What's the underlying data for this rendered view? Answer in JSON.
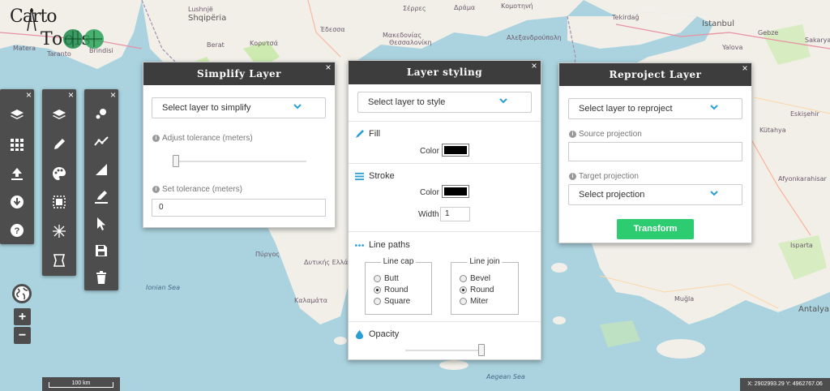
{
  "app": {
    "logo_line1": "Carto",
    "logo_line2": "Tools"
  },
  "map": {
    "labels": [
      {
        "text": "Lushnjë",
        "cls": ""
      },
      {
        "text": "Shqipëria",
        "cls": "big"
      },
      {
        "text": "Berat",
        "cls": ""
      },
      {
        "text": "Κορυτσά",
        "cls": ""
      },
      {
        "text": "Σέρρες",
        "cls": ""
      },
      {
        "text": "Δράμα",
        "cls": ""
      },
      {
        "text": "Κομοτηνή",
        "cls": ""
      },
      {
        "text": "Θεσσαλονίκη",
        "cls": ""
      },
      {
        "text": "Έδεσσα",
        "cls": ""
      },
      {
        "text": "Μακεδονίας",
        "cls": ""
      },
      {
        "text": "Αλεξανδρούπολη",
        "cls": ""
      },
      {
        "text": "Tekirdağ",
        "cls": ""
      },
      {
        "text": "Istanbul",
        "cls": "big"
      },
      {
        "text": "Gebze",
        "cls": ""
      },
      {
        "text": "Sakarya",
        "cls": ""
      },
      {
        "text": "Yalova",
        "cls": ""
      },
      {
        "text": "Matera",
        "cls": ""
      },
      {
        "text": "Taranto",
        "cls": ""
      },
      {
        "text": "Brindisi",
        "cls": ""
      },
      {
        "text": "Eskişehir",
        "cls": ""
      },
      {
        "text": "Kütahya",
        "cls": ""
      },
      {
        "text": "Afyonkarahisar",
        "cls": ""
      },
      {
        "text": "Isparta",
        "cls": ""
      },
      {
        "text": "Muğla",
        "cls": ""
      },
      {
        "text": "Antalya",
        "cls": "big"
      },
      {
        "text": "Πύργος",
        "cls": ""
      },
      {
        "text": "Δυτικής Ελλάδας",
        "cls": ""
      },
      {
        "text": "Καλαμάτα",
        "cls": ""
      },
      {
        "text": "Ionian Sea",
        "cls": "blue"
      },
      {
        "text": "Aegean Sea",
        "cls": "blue"
      }
    ]
  },
  "toolbar1": {
    "close": "×",
    "tools": [
      "layers-icon",
      "grid-icon",
      "upload-icon",
      "download-icon",
      "help-icon"
    ]
  },
  "toolbar2": {
    "close": "×",
    "tools": [
      "layers-icon",
      "pencil-icon",
      "palette-icon",
      "select-box-icon",
      "scatter-icon",
      "shape-icon"
    ]
  },
  "toolbar3": {
    "close": "×",
    "tools": [
      "points-icon",
      "line-icon",
      "polygon-icon",
      "edit-line-icon",
      "pointer-icon",
      "save-icon",
      "trash-icon"
    ]
  },
  "zoom": {
    "plus": "+",
    "minus": "−"
  },
  "simplify": {
    "title": "Simplify Layer",
    "close": "×",
    "select_placeholder": "Select layer to simplify",
    "adjust_label": "Adjust tolerance (meters)",
    "adjust_value": 0.0,
    "set_label": "Set tolerance (meters)",
    "set_value": "0"
  },
  "styling": {
    "title": "Layer styling",
    "close": "×",
    "select_placeholder": "Select layer to style",
    "fill_title": "Fill",
    "fill_color_label": "Color",
    "fill_color": "#000000",
    "stroke_title": "Stroke",
    "stroke_color_label": "Color",
    "stroke_color": "#000000",
    "width_label": "Width",
    "width_value": "1",
    "linepaths_title": "Line paths",
    "linecap_legend": "Line cap",
    "linecap_options": [
      "Butt",
      "Round",
      "Square"
    ],
    "linecap_selected": 1,
    "linejoin_legend": "Line join",
    "linejoin_options": [
      "Bevel",
      "Round",
      "Miter"
    ],
    "linejoin_selected": 1,
    "opacity_title": "Opacity",
    "opacity_value": 1.0
  },
  "reproject": {
    "title": "Reproject Layer",
    "close": "×",
    "select_placeholder": "Select layer to reproject",
    "source_label": "Source projection",
    "source_value": "",
    "target_label": "Target projection",
    "target_placeholder": "Select projection",
    "transform_label": "Transform"
  },
  "footer": {
    "scale_text": "100 km",
    "coords_text": "X: 2902993.29  Y: 4962767.06"
  },
  "colors": {
    "toolbar_bg": "#4d4d4d",
    "panel_header": "#3d3d3d",
    "accent_blue": "#2a9fd6",
    "transform_green": "#2ecc71",
    "sea": "#aad3df",
    "land": "#f2efe9"
  }
}
